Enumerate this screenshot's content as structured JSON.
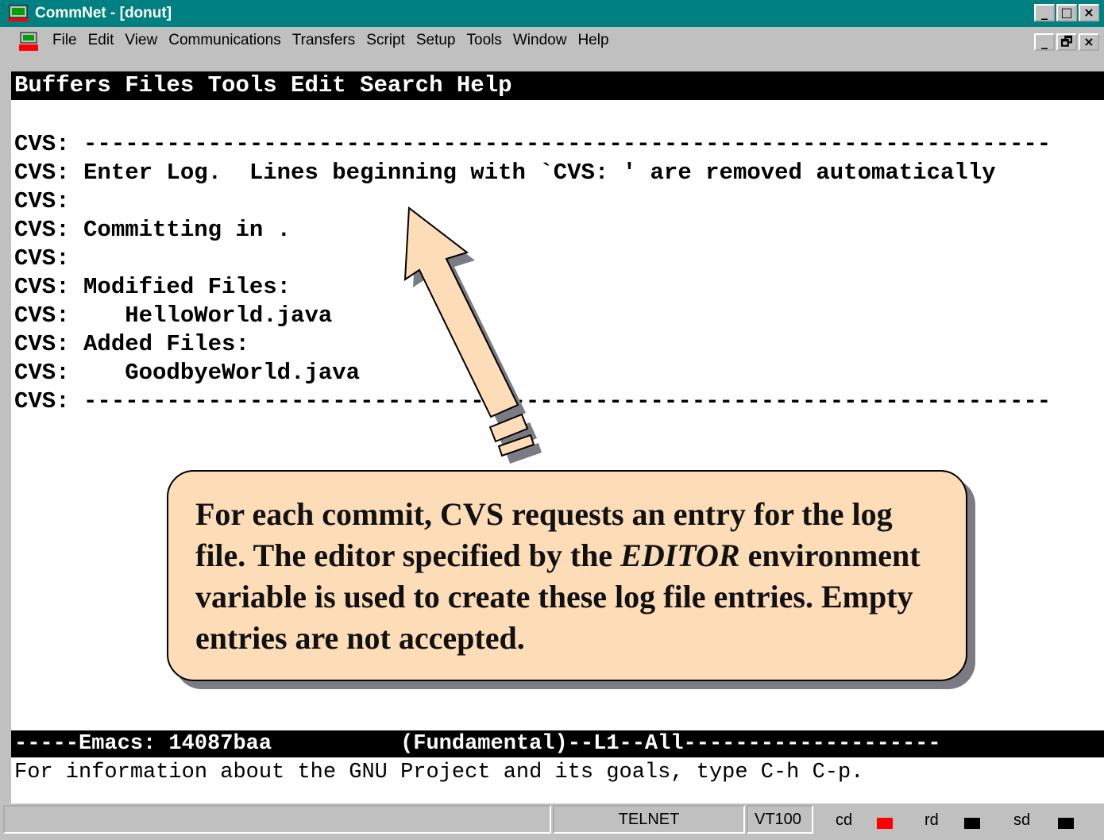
{
  "window": {
    "title": "CommNet - [donut]",
    "buttons": [
      "_",
      "□",
      "×"
    ]
  },
  "menubar": {
    "items": [
      "File",
      "Edit",
      "View",
      "Communications",
      "Transfers",
      "Script",
      "Setup",
      "Tools",
      "Window",
      "Help"
    ],
    "mdi_buttons": [
      "_",
      "🗗",
      "×"
    ]
  },
  "emacs": {
    "menu": "Buffers Files Tools Edit Search Help",
    "lines": [
      "",
      "CVS: ----------------------------------------------------------------------",
      "CVS: Enter Log.  Lines beginning with `CVS: ' are removed automatically",
      "CVS:",
      "CVS: Committing in .",
      "CVS:",
      "CVS: Modified Files:",
      "CVS:    HelloWorld.java",
      "CVS: Added Files:",
      "CVS:    GoodbyeWorld.java",
      "CVS: ----------------------------------------------------------------------"
    ],
    "modeline": "-----Emacs: 14087baa          (Fundamental)--L1--All--------------------",
    "echo": "For information about the GNU Project and its goals, type C-h C-p."
  },
  "callout": {
    "text_part1": "For each commit, CVS requests an entry for the log file. The editor specified by the ",
    "text_emph": "EDITOR",
    "text_part2": " environment variable is used to create these log file entries. Empty entries are not accepted."
  },
  "statusbar": {
    "protocol": "TELNET",
    "terminal": "VT100",
    "indicators": [
      "cd",
      "rd",
      "sd"
    ],
    "colors": {
      "cd": "#ff0000",
      "rd": "#000000",
      "sd": "#000000"
    }
  }
}
